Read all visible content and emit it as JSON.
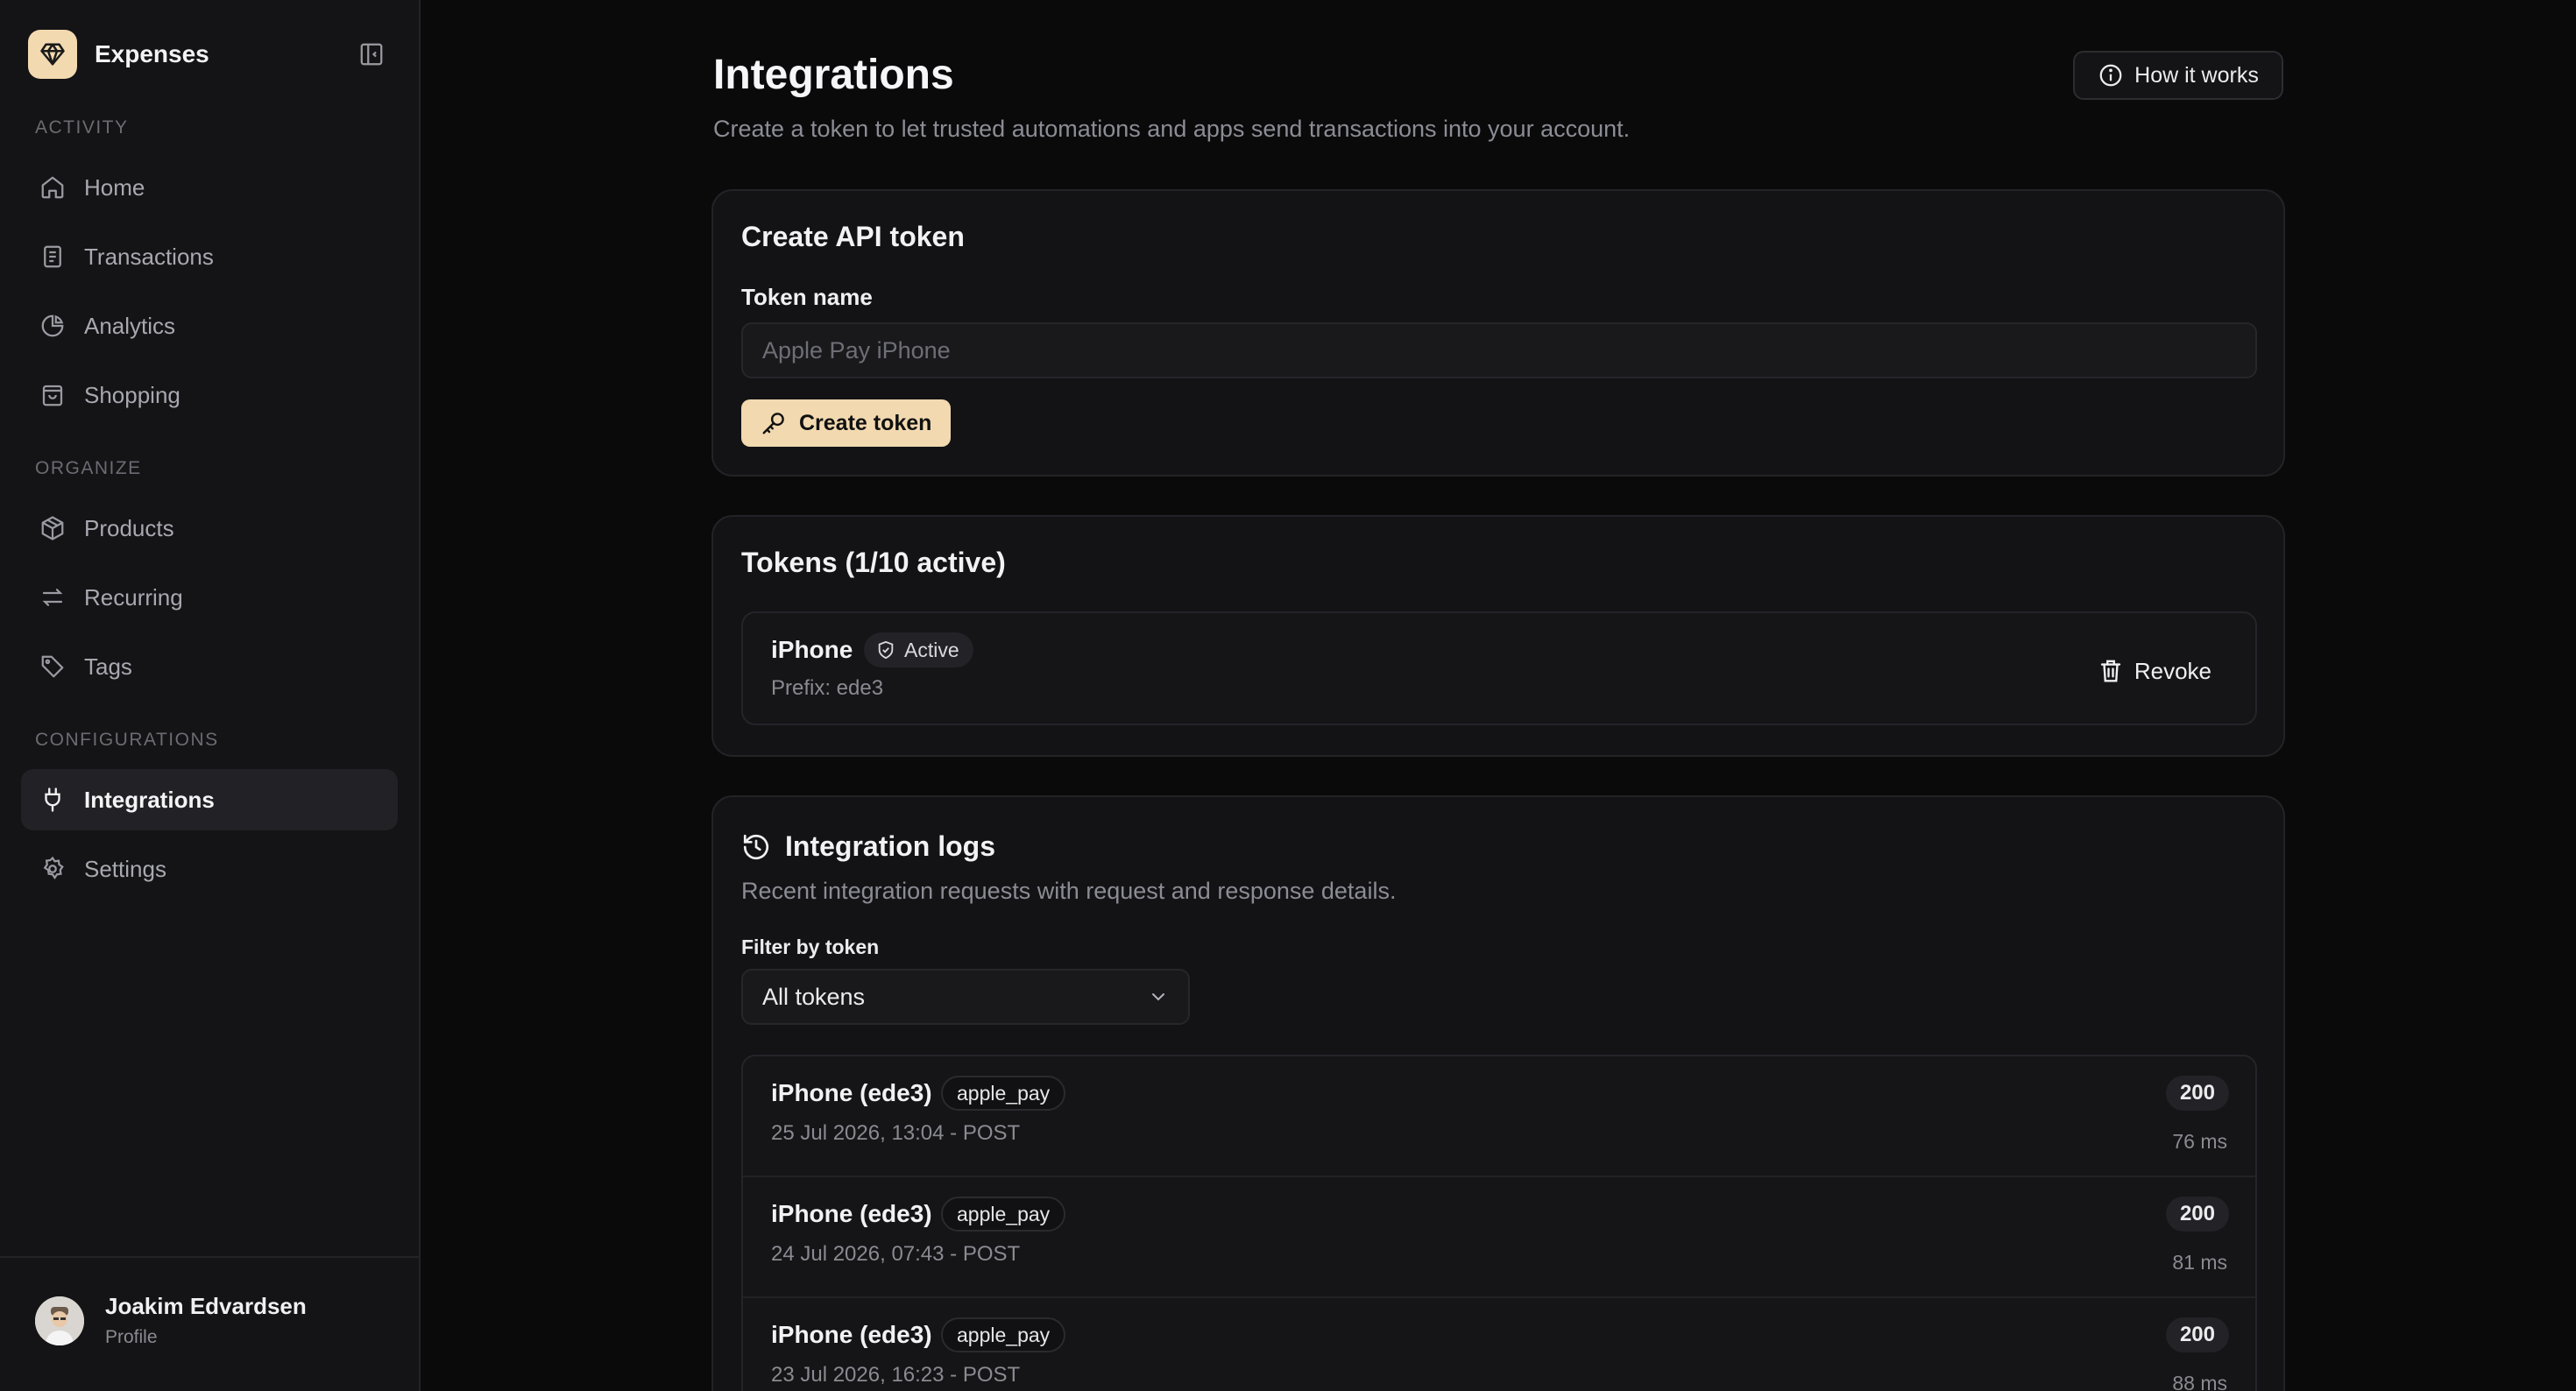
{
  "app": {
    "name": "Expenses"
  },
  "sidebar": {
    "sections": [
      {
        "label": "ACTIVITY"
      },
      {
        "label": "ORGANIZE"
      },
      {
        "label": "CONFIGURATIONS"
      }
    ],
    "items": [
      {
        "label": "Home",
        "icon": "home-icon"
      },
      {
        "label": "Transactions",
        "icon": "receipt-icon"
      },
      {
        "label": "Analytics",
        "icon": "pie-chart-icon"
      },
      {
        "label": "Shopping",
        "icon": "shopping-bag-icon"
      },
      {
        "label": "Products",
        "icon": "package-icon"
      },
      {
        "label": "Recurring",
        "icon": "repeat-icon"
      },
      {
        "label": "Tags",
        "icon": "tag-icon"
      },
      {
        "label": "Integrations",
        "icon": "plug-icon",
        "active": true
      },
      {
        "label": "Settings",
        "icon": "gear-icon"
      }
    ],
    "user": {
      "name": "Joakim Edvardsen",
      "subtitle": "Profile"
    }
  },
  "header": {
    "title": "Integrations",
    "subtitle": "Create a token to let trusted automations and apps send transactions into your account.",
    "how_it_works": "How it works"
  },
  "create_token": {
    "title": "Create API token",
    "field_label": "Token name",
    "placeholder": "Apple Pay iPhone",
    "button": "Create token"
  },
  "tokens": {
    "title": "Tokens (1/10 active)",
    "items": [
      {
        "name": "iPhone",
        "status": "Active",
        "prefix": "Prefix: ede3",
        "revoke": "Revoke"
      }
    ]
  },
  "logs": {
    "title": "Integration logs",
    "subtitle": "Recent integration requests with request and response details.",
    "filter_label": "Filter by token",
    "filter_value": "All tokens",
    "rows": [
      {
        "title": "iPhone (ede3)",
        "tag": "apple_pay",
        "meta": "25 Jul 2026, 13:04 - POST",
        "status": "200",
        "duration": "76 ms"
      },
      {
        "title": "iPhone (ede3)",
        "tag": "apple_pay",
        "meta": "24 Jul 2026, 07:43 - POST",
        "status": "200",
        "duration": "81 ms"
      },
      {
        "title": "iPhone (ede3)",
        "tag": "apple_pay",
        "meta": "23 Jul 2026, 16:23 - POST",
        "status": "200",
        "duration": "88 ms"
      }
    ]
  },
  "colors": {
    "accent": "#f2d9b0",
    "background": "#0a0a0b",
    "sidebar": "#141416",
    "card": "#131315"
  }
}
